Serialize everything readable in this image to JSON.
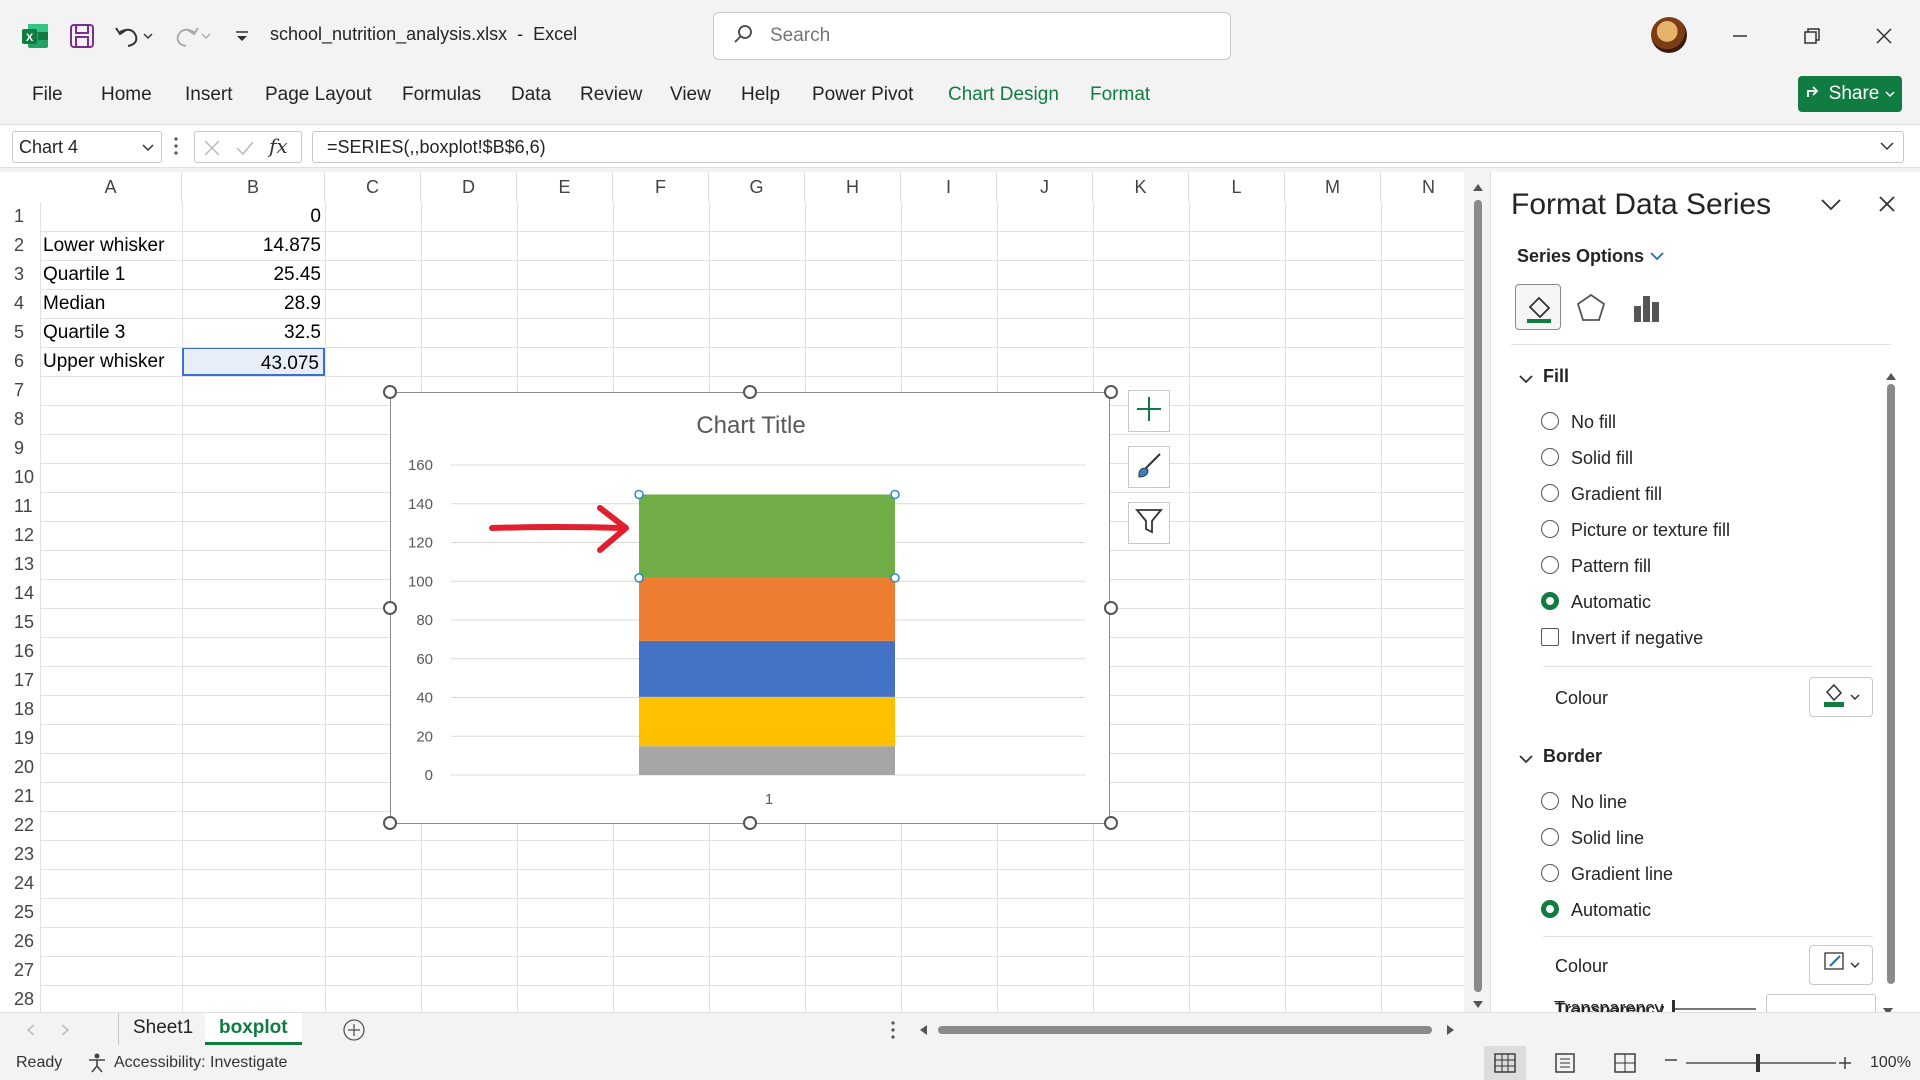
{
  "app": {
    "file_name": "school_nutrition_analysis.xlsx",
    "separator": "-",
    "app_name": "Excel",
    "search_placeholder": "Search",
    "brand_color": "#107c41"
  },
  "ribbon": {
    "tabs": [
      "File",
      "Home",
      "Insert",
      "Page Layout",
      "Formulas",
      "Data",
      "Review",
      "View",
      "Help",
      "Power Pivot",
      "Chart Design",
      "Format"
    ],
    "share_label": "Share"
  },
  "formula_bar": {
    "name_box": "Chart 4",
    "formula": "=SERIES(,,boxplot!$B$6,6)",
    "fx": "fx"
  },
  "sheet": {
    "columns": [
      "A",
      "B",
      "C",
      "D",
      "E",
      "F",
      "G",
      "H",
      "I",
      "J",
      "K",
      "L",
      "M",
      "N"
    ],
    "rows": [
      "1",
      "2",
      "3",
      "4",
      "5",
      "6",
      "7",
      "8",
      "9",
      "10",
      "11",
      "12",
      "13",
      "14",
      "15",
      "16",
      "17",
      "18",
      "19",
      "20",
      "21",
      "22",
      "23",
      "24",
      "25",
      "26",
      "27",
      "28"
    ],
    "cells": {
      "B1": "0",
      "A2": "Lower whisker",
      "B2": "14.875",
      "A3": "Quartile 1",
      "B3": "25.45",
      "A4": "Median",
      "B4": "28.9",
      "A5": "Quartile 3",
      "B5": "32.5",
      "A6": "Upper whisker",
      "B6": "43.075"
    }
  },
  "chart_data": {
    "type": "bar",
    "title": "Chart Title",
    "categories": [
      "1"
    ],
    "stacked": true,
    "ylim": [
      0,
      160
    ],
    "yticks": [
      "0",
      "20",
      "40",
      "60",
      "80",
      "100",
      "120",
      "140",
      "160"
    ],
    "grid": true,
    "series": [
      {
        "values": [
          14.875
        ],
        "color": "#a5a5a5"
      },
      {
        "values": [
          25.45
        ],
        "color": "#ffc000"
      },
      {
        "values": [
          28.9
        ],
        "color": "#4472c4"
      },
      {
        "values": [
          32.5
        ],
        "color": "#ed7d31"
      },
      {
        "values": [
          43.075
        ],
        "color": "#70ad47"
      }
    ]
  },
  "pane": {
    "title": "Format Data Series",
    "options_label": "Series Options",
    "fill": {
      "header": "Fill",
      "options": [
        "No fill",
        "Solid fill",
        "Gradient fill",
        "Picture or texture fill",
        "Pattern fill",
        "Automatic"
      ],
      "selected": "Automatic",
      "invert_label": "Invert if negative",
      "colour_label": "Colour"
    },
    "border": {
      "header": "Border",
      "options": [
        "No line",
        "Solid line",
        "Gradient line",
        "Automatic"
      ],
      "selected": "Automatic",
      "colour_label": "Colour",
      "transparency_label": "Transparency"
    }
  },
  "bottom": {
    "sheets": [
      "Sheet1",
      "boxplot"
    ],
    "active_sheet": "boxplot",
    "status": "Ready",
    "accessibility": "Accessibility: Investigate",
    "zoom": "100%"
  }
}
